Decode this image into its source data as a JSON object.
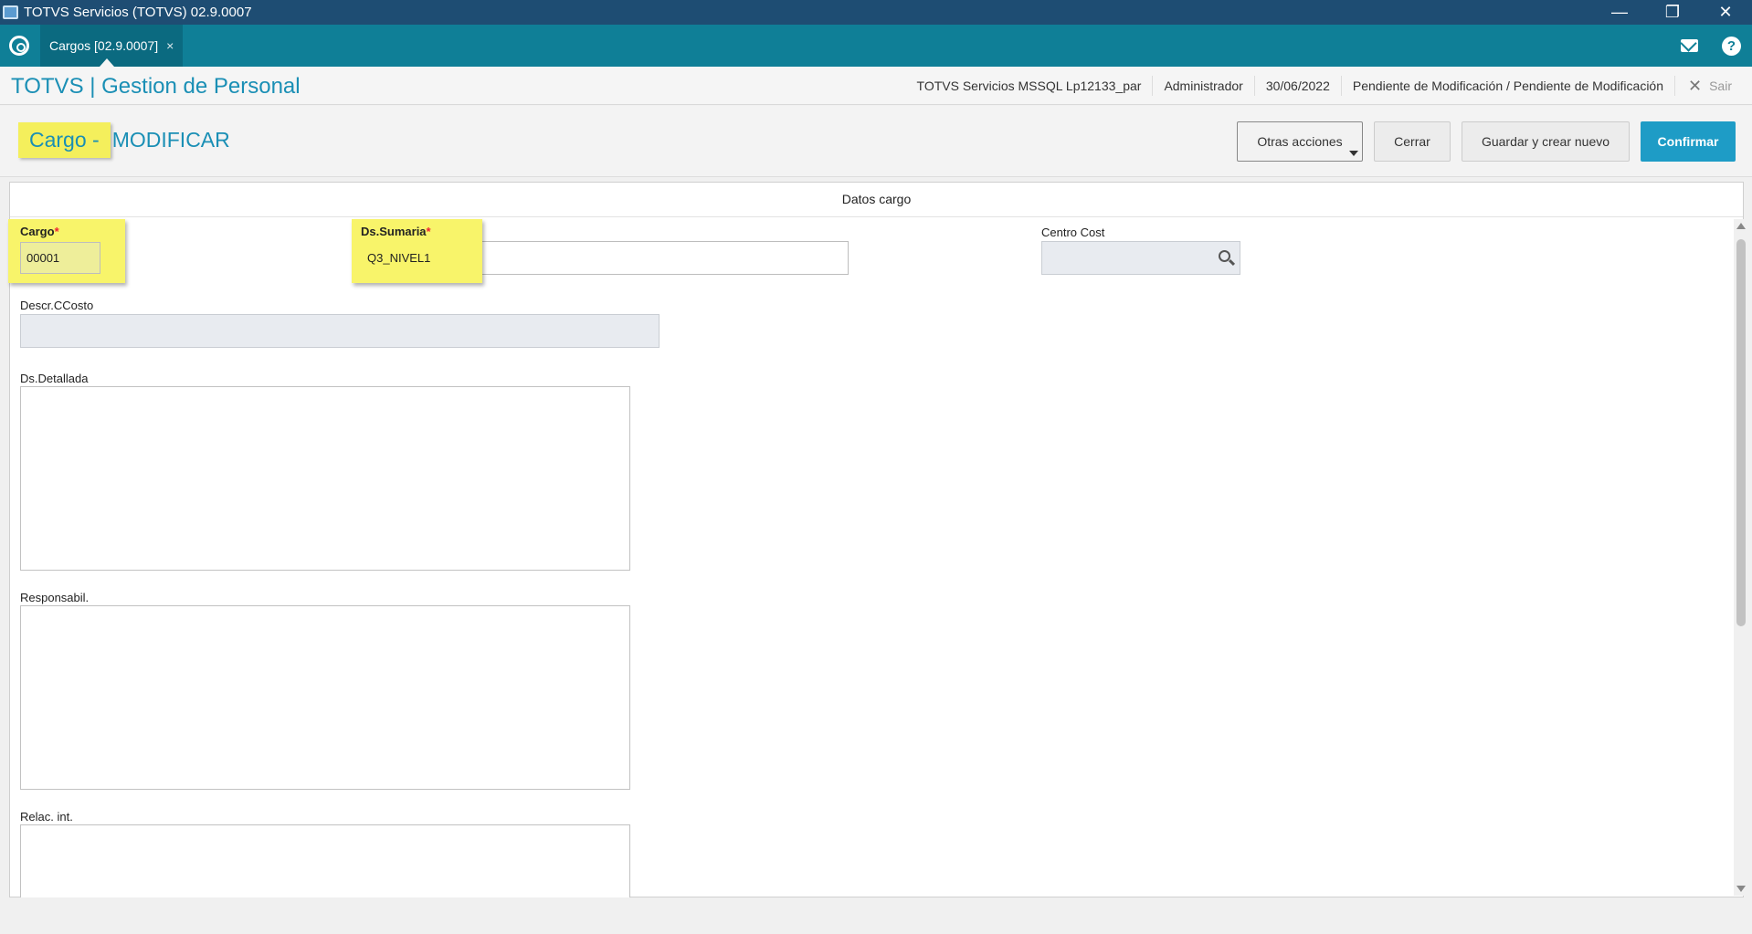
{
  "window": {
    "title": "TOTVS Servicios (TOTVS) 02.9.0007",
    "minimize": "—",
    "restore": "❐",
    "close": "✕"
  },
  "tabbar": {
    "tab_label": "Cargos [02.9.0007]",
    "tab_close": "×",
    "help": "?"
  },
  "header": {
    "app_title": "TOTVS | Gestion de Personal",
    "environment": "TOTVS Servicios MSSQL Lp12133_par",
    "user": "Administrador",
    "date": "30/06/2022",
    "status": "Pendiente de Modificación / Pendiente de Modificación",
    "exit_label": "Sair"
  },
  "page": {
    "entity": "Cargo - ",
    "mode": "MODIFICAR"
  },
  "toolbar": {
    "more_actions": "Otras acciones",
    "close": "Cerrar",
    "save_and_new": "Guardar y crear nuevo",
    "confirm": "Confirmar"
  },
  "form": {
    "section_title": "Datos cargo",
    "cargo": {
      "label": "Cargo",
      "required": "*",
      "value": "00001"
    },
    "ds_sumaria": {
      "label": "Ds.Sumaria",
      "required": "*",
      "value": "Q3_NIVEL1"
    },
    "centro_cost": {
      "label": "Centro Cost",
      "value": ""
    },
    "descr_ccosto": {
      "label": "Descr.CCosto",
      "value": ""
    },
    "ds_detallada": {
      "label": "Ds.Detallada",
      "value": ""
    },
    "responsabil": {
      "label": "Responsabil.",
      "value": ""
    },
    "relac_int": {
      "label": "Relac. int.",
      "value": ""
    }
  },
  "colors": {
    "titlebar": "#1e4d73",
    "tabbar": "#0f7f97",
    "accent": "#1a8fb5",
    "confirm_button": "#1e9cc6",
    "highlight": "#f4ef5c"
  }
}
